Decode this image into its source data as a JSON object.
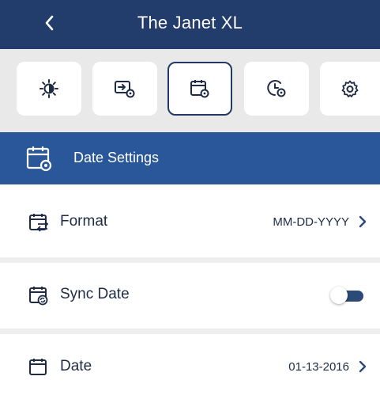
{
  "header": {
    "title": "The Janet XL",
    "back_icon": "chevron-left-icon"
  },
  "tabs": [
    {
      "icon": "brightness-icon",
      "active": false
    },
    {
      "icon": "display-settings-icon",
      "active": false
    },
    {
      "icon": "calendar-settings-icon",
      "active": true
    },
    {
      "icon": "clock-settings-icon",
      "active": false
    },
    {
      "icon": "gear-icon",
      "active": false
    }
  ],
  "section": {
    "title": "Date Settings",
    "icon": "calendar-settings-icon"
  },
  "rows": {
    "format": {
      "label": "Format",
      "value": "MM-DD-YYYY",
      "icon": "calendar-swap-icon"
    },
    "sync_date": {
      "label": "Sync Date",
      "enabled": false,
      "icon": "calendar-sync-icon"
    },
    "date": {
      "label": "Date",
      "value": "01-13-2016",
      "icon": "calendar-icon"
    }
  },
  "colors": {
    "header": "#223d6b",
    "section": "#2a5799",
    "accent": "#2b4a78",
    "background": "#eeeeee"
  }
}
